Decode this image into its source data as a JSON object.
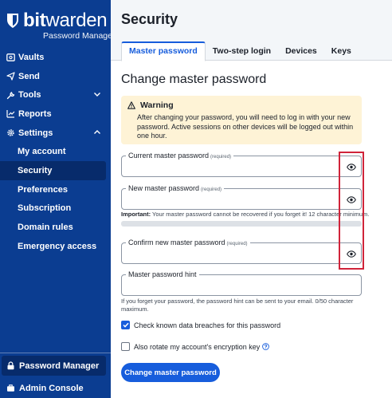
{
  "brand": {
    "name_bit": "bit",
    "name_warden": "warden",
    "subtitle": "Password Manager"
  },
  "sidebar": {
    "items": [
      {
        "label": "Vaults",
        "icon": "vault-icon"
      },
      {
        "label": "Send",
        "icon": "send-icon"
      },
      {
        "label": "Tools",
        "icon": "wrench-icon",
        "chevron": "chevron-down-icon"
      },
      {
        "label": "Reports",
        "icon": "reports-icon"
      },
      {
        "label": "Settings",
        "icon": "gear-icon",
        "chevron": "chevron-up-icon"
      }
    ],
    "settings_children": [
      {
        "label": "My account"
      },
      {
        "label": "Security",
        "active": true
      },
      {
        "label": "Preferences"
      },
      {
        "label": "Subscription"
      },
      {
        "label": "Domain rules"
      },
      {
        "label": "Emergency access"
      }
    ],
    "bottom": [
      {
        "label": "Password Manager",
        "icon": "lock-icon",
        "active": true
      },
      {
        "label": "Admin Console",
        "icon": "briefcase-icon"
      }
    ]
  },
  "header": {
    "title": "Security",
    "tabs": [
      {
        "label": "Master password",
        "active": true
      },
      {
        "label": "Two-step login"
      },
      {
        "label": "Devices"
      },
      {
        "label": "Keys"
      }
    ]
  },
  "form": {
    "heading": "Change master password",
    "warning": {
      "title": "Warning",
      "body": "After changing your password, you will need to log in with your new password. Active sessions on other devices will be logged out within one hour."
    },
    "current_password": {
      "label": "Current master password",
      "required": "(required)",
      "value": ""
    },
    "new_password": {
      "label": "New master password",
      "required": "(required)",
      "value": ""
    },
    "important_label": "Important:",
    "important_text": " Your master password cannot be recovered if you forget it! 12 character minimum.",
    "confirm_password": {
      "label": "Confirm new master password",
      "required": "(required)",
      "value": ""
    },
    "hint": {
      "label": "Master password hint",
      "value": ""
    },
    "hint_help": "If you forget your password, the password hint can be sent to your email. 0/50 character maximum.",
    "check_breaches": {
      "label": "Check known data breaches for this password",
      "checked": true
    },
    "rotate_key": {
      "label": "Also rotate my account's encryption key",
      "checked": false
    },
    "submit_label": "Change master password"
  },
  "colors": {
    "accent": "#175ddc",
    "sidebar": "#0b3d91",
    "warning_bg": "#fef3d6",
    "highlight": "#d0243a"
  }
}
